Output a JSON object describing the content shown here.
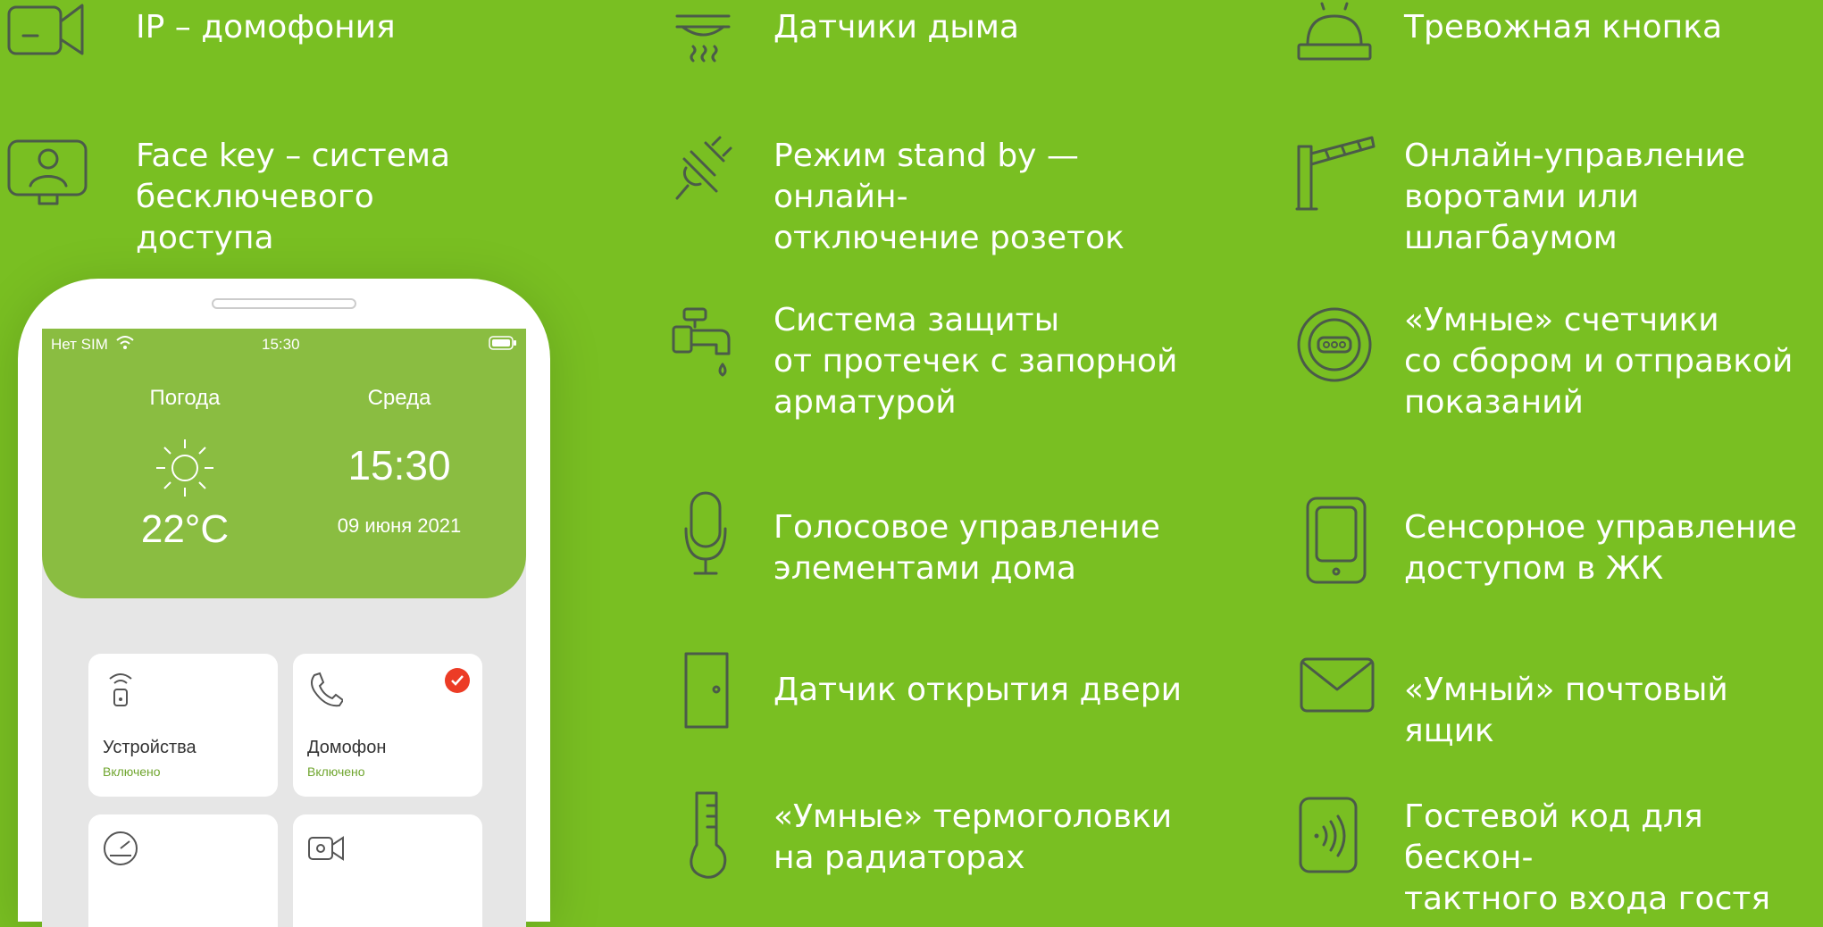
{
  "features": [
    {
      "id": "ip-intercom",
      "icon": "video-camera-icon",
      "label": "IP – домофония"
    },
    {
      "id": "face-key",
      "icon": "face-recognition-icon",
      "label": "Face key – система\nбесключевого доступа"
    },
    {
      "id": "smoke",
      "icon": "smoke-detector-icon",
      "label": "Датчики дыма"
    },
    {
      "id": "standby",
      "icon": "plug-icon",
      "label": "Режим stand by — онлайн-\nотключение розеток"
    },
    {
      "id": "leak",
      "icon": "water-tap-icon",
      "label": "Система защиты\nот протечек с запорной\nарматурой"
    },
    {
      "id": "voice",
      "icon": "microphone-icon",
      "label": "Голосовое управление\nэлементами дома"
    },
    {
      "id": "door",
      "icon": "door-icon",
      "label": "Датчик открытия двери"
    },
    {
      "id": "thermo",
      "icon": "thermometer-icon",
      "label": "«Умные» термоголовки\nна радиаторах"
    },
    {
      "id": "panic",
      "icon": "alarm-bell-icon",
      "label": "Тревожная кнопка"
    },
    {
      "id": "gate",
      "icon": "barrier-gate-icon",
      "label": "Онлайн-управление\nворотами или шлагбаумом"
    },
    {
      "id": "meters",
      "icon": "meter-icon",
      "label": "«Умные» счетчики\nсо сбором и отправкой\nпоказаний"
    },
    {
      "id": "touch",
      "icon": "smartphone-icon",
      "label": "Сенсорное управление\nдоступом в ЖК"
    },
    {
      "id": "mailbox",
      "icon": "envelope-icon",
      "label": "«Умный» почтовый ящик"
    },
    {
      "id": "guest",
      "icon": "contactless-icon",
      "label": "Гостевой код  для бескон-\nтактного  входа гостя"
    }
  ],
  "phone": {
    "status_carrier": "Нет SIM",
    "status_time": "15:30",
    "weather_label": "Погода",
    "weather_temp": "22°C",
    "day_label": "Среда",
    "clock": "15:30",
    "date": "09 июня 2021",
    "tiles": [
      {
        "title": "Устройства",
        "status": "Включено",
        "icon": "device-icon"
      },
      {
        "title": "Домофон",
        "status": "Включено",
        "icon": "phone-handset-icon"
      },
      {
        "title": "",
        "status": "",
        "icon": "gauge-icon"
      },
      {
        "title": "",
        "status": "",
        "icon": "camera-icon"
      }
    ]
  },
  "colors": {
    "background": "#79bf22",
    "header": "#8abd41",
    "icon_stroke": "#4b5b49",
    "badge": "#ec3c26"
  }
}
